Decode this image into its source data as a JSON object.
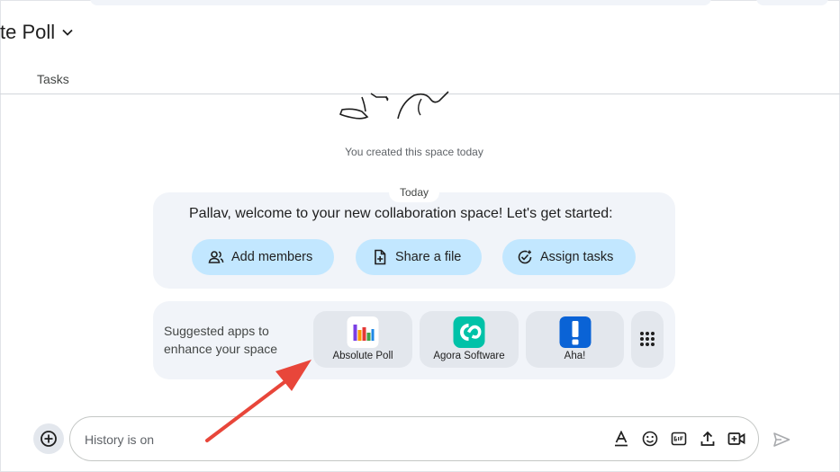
{
  "header": {
    "space_title": "te Poll",
    "tabs": [
      {
        "label": "Tasks"
      }
    ]
  },
  "main": {
    "created_text": "You created this space today",
    "date_divider": "Today",
    "welcome": {
      "message": "Pallav, welcome to your new collaboration space! Let's get started:",
      "actions": [
        {
          "label": "Add members",
          "icon": "add-members-icon"
        },
        {
          "label": "Share a file",
          "icon": "share-file-icon"
        },
        {
          "label": "Assign tasks",
          "icon": "assign-tasks-icon"
        }
      ]
    },
    "suggested_apps": {
      "label": "Suggested apps to enhance your space",
      "apps": [
        {
          "name": "Absolute Poll",
          "icon": "bar-chart-logo"
        },
        {
          "name": "Agora Software",
          "icon": "agora-logo"
        },
        {
          "name": "Aha!",
          "icon": "exclamation-logo"
        }
      ],
      "more_icon": "apps-grid-icon"
    }
  },
  "composer": {
    "placeholder": "History is on",
    "tools": [
      "format-text-icon",
      "emoji-icon",
      "gif-icon",
      "upload-icon",
      "video-meeting-icon"
    ],
    "send_icon": "send-icon"
  },
  "colors": {
    "chip_bg": "#c2e7ff",
    "card_bg": "#f1f4f9",
    "tile_bg": "#e3e7ed",
    "annotation_arrow": "#e8463a",
    "agora_teal": "#00c2a8",
    "aha_blue": "#0a63d6"
  }
}
